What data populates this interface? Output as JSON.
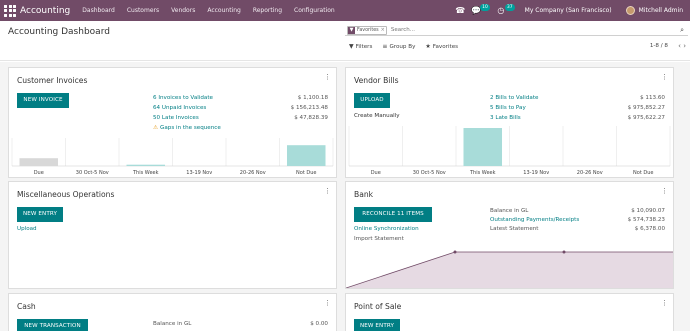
{
  "navbar": {
    "brand": "Accounting",
    "menu": [
      "Dashboard",
      "Customers",
      "Vendors",
      "Accounting",
      "Reporting",
      "Configuration"
    ],
    "messages_count": "10",
    "activities_count": "37",
    "company": "My Company (San Francisco)",
    "user": "Mitchell Admin"
  },
  "control_panel": {
    "title": "Accounting Dashboard",
    "facet_label": "Favorites",
    "search_placeholder": "Search...",
    "filters_label": "Filters",
    "groupby_label": "Group By",
    "favorites_label": "Favorites",
    "pager": "1-8 / 8"
  },
  "cards": {
    "customer_invoices": {
      "title": "Customer Invoices",
      "button": "NEW INVOICE",
      "rows": [
        {
          "label": "6 Invoices to Validate",
          "value": "$ 1,100.18"
        },
        {
          "label": "64 Unpaid Invoices",
          "value": "$ 156,213.48"
        },
        {
          "label": "50 Late Invoices",
          "value": "$ 47,828.39"
        }
      ],
      "warning": "Gaps in the sequence",
      "chart_data": {
        "type": "bar",
        "categories": [
          "Due",
          "30 Oct-5 Nov",
          "This Week",
          "13-19 Nov",
          "20-26 Nov",
          "Not Due"
        ],
        "values": [
          12,
          0,
          2,
          0,
          0,
          32
        ],
        "colors": [
          "#d8d8d8",
          "#d8d8d8",
          "#a8dcd9",
          "#a8dcd9",
          "#a8dcd9",
          "#a8dcd9"
        ],
        "ylim": [
          0,
          40
        ]
      }
    },
    "vendor_bills": {
      "title": "Vendor Bills",
      "button": "UPLOAD",
      "create_manually": "Create Manually",
      "rows": [
        {
          "label": "2 Bills to Validate",
          "value": "$ 113.60"
        },
        {
          "label": "5 Bills to Pay",
          "value": "$ 975,852.27"
        },
        {
          "label": "3 Late Bills",
          "value": "$ 975,622.27"
        }
      ],
      "chart_data": {
        "type": "bar",
        "categories": [
          "Due",
          "30 Oct-5 Nov",
          "This Week",
          "13-19 Nov",
          "20-26 Nov",
          "Not Due"
        ],
        "values": [
          0,
          0,
          45,
          0,
          0,
          0
        ],
        "colors": [
          "#d8d8d8",
          "#d8d8d8",
          "#a8dcd9",
          "#a8dcd9",
          "#a8dcd9",
          "#a8dcd9"
        ],
        "ylim": [
          0,
          45
        ]
      }
    },
    "misc": {
      "title": "Miscellaneous Operations",
      "button": "NEW ENTRY",
      "upload": "Upload"
    },
    "bank": {
      "title": "Bank",
      "button": "RECONCILE 11 ITEMS",
      "online_sync": "Online Synchronization",
      "import_statement": "Import Statement",
      "rows": [
        {
          "label": "Balance in GL",
          "value": "$ 10,090.07"
        },
        {
          "label": "Outstanding Payments/Receipts",
          "value": "$ 574,738.23"
        },
        {
          "label": "Latest Statement",
          "value": "$ 6,378.00"
        }
      ],
      "chart_data": {
        "type": "area",
        "x": [
          0,
          1,
          2,
          3
        ],
        "y": [
          0,
          0.85,
          0.85,
          0.85
        ],
        "color": "#714b67",
        "fill": "#e6dae3"
      }
    },
    "cash": {
      "title": "Cash",
      "button": "NEW TRANSACTION",
      "rows": [
        {
          "label": "Balance in GL",
          "value": "$ 0.00"
        }
      ]
    },
    "pos": {
      "title": "Point of Sale",
      "button": "NEW ENTRY"
    }
  }
}
